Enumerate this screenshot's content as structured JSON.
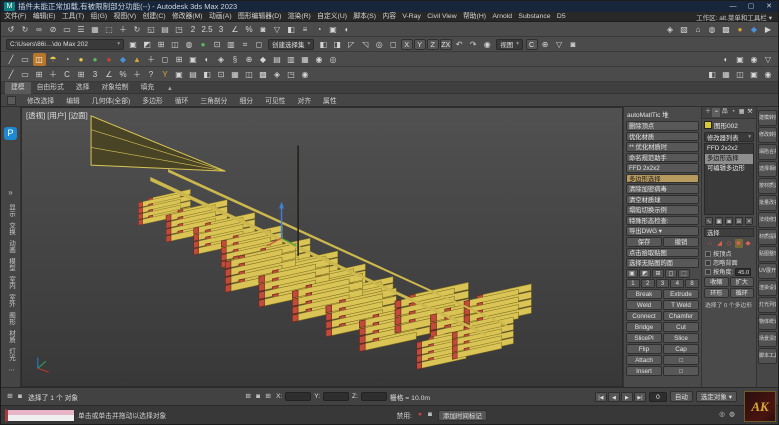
{
  "titlebar": {
    "app_icon": "M",
    "title": "插件未能正常加载,有被限制部分功能(--) - Autodesk 3ds Max 2023",
    "minimize": "—",
    "maximize": "▢",
    "close": "✕"
  },
  "menubar": {
    "items": [
      "文件(F)",
      "编辑(E)",
      "工具(T)",
      "组(G)",
      "视图(V)",
      "创建(C)",
      "修改器(M)",
      "动画(A)",
      "图形编辑器(D)",
      "渲染(R)",
      "自定义(U)",
      "脚本(S)",
      "内容",
      "V-Ray",
      "Civil View",
      "帮助(H)",
      "Arnold",
      "Substance",
      "D5"
    ],
    "workspace": "工作区: alt.菜单和工具栏 ▾"
  },
  "toolbar_row1": {
    "icons": [
      {
        "g": "↺"
      },
      {
        "g": "↻"
      },
      {
        "g": "∞"
      },
      {
        "g": "⊘"
      },
      {
        "g": "▭"
      },
      {
        "g": "☰"
      },
      {
        "g": "▦"
      },
      {
        "g": "⬚"
      },
      {
        "g": "＋"
      },
      {
        "g": "↻"
      },
      {
        "g": "◱"
      },
      {
        "g": "▤"
      },
      {
        "g": "◳"
      },
      {
        "g": "2"
      },
      {
        "g": "2.5"
      },
      {
        "g": "3"
      },
      {
        "g": "∠"
      },
      {
        "g": "%"
      },
      {
        "g": "◙"
      },
      {
        "g": "▽"
      },
      {
        "g": "◧"
      },
      {
        "g": "≡"
      },
      {
        "g": "◔"
      },
      {
        "g": "▣"
      },
      {
        "g": "◐"
      }
    ],
    "icons_right": [
      {
        "g": "◈"
      },
      {
        "g": "▧"
      },
      {
        "g": "⌂"
      },
      {
        "g": "◍"
      },
      {
        "g": "▩"
      },
      {
        "g": "●",
        "c": "#d9a33a"
      },
      {
        "g": "◆",
        "c": "#4a90d9"
      },
      {
        "g": "▶"
      }
    ]
  },
  "toolbar_row2": {
    "path": "C:\\Users\\86i…\\do Max 202",
    "icons_a": [
      {
        "g": "▣"
      },
      {
        "g": "◩"
      },
      {
        "g": "⊞"
      },
      {
        "g": "◫"
      },
      {
        "g": "◍"
      },
      {
        "g": "●",
        "c": "#5cb85c"
      },
      {
        "g": "⊡"
      },
      {
        "g": "▥"
      },
      {
        "g": "⌗"
      },
      {
        "g": "◻"
      }
    ],
    "sel_combo": "创建选择集",
    "icons_b": [
      {
        "g": "◧"
      },
      {
        "g": "◨"
      },
      {
        "g": "◸"
      },
      {
        "g": "◹"
      },
      {
        "g": "◎"
      },
      {
        "g": "◻"
      }
    ],
    "axis": [
      "X",
      "Y",
      "Z",
      "ZX"
    ],
    "icons_c": [
      {
        "g": "↶"
      },
      {
        "g": "↷"
      },
      {
        "g": "◉"
      }
    ],
    "view_combo": "视图",
    "c_btn": "C",
    "icons_d": [
      {
        "g": "⊕"
      },
      {
        "g": "▽"
      },
      {
        "g": "◙"
      }
    ]
  },
  "toolbar_row3": {
    "icons": [
      {
        "g": "╱"
      },
      {
        "g": "▭"
      },
      {
        "g": "◫",
        "bg": "#b8762a",
        "c": "#ffffff"
      },
      {
        "g": "☂",
        "c": "#e6c84a"
      },
      {
        "g": "◔"
      },
      {
        "g": "●",
        "c": "#e6c84a"
      },
      {
        "g": "●",
        "c": "#5cb85c"
      },
      {
        "g": "●",
        "c": "#cc4433"
      },
      {
        "g": "◆",
        "c": "#4a90d9"
      },
      {
        "g": "▲",
        "c": "#d9a33a"
      },
      {
        "g": "＋"
      },
      {
        "g": "◻"
      },
      {
        "g": "⊞"
      },
      {
        "g": "▣"
      },
      {
        "g": "◐"
      },
      {
        "g": "◈"
      },
      {
        "g": "§"
      },
      {
        "g": "⊕"
      },
      {
        "g": "◆"
      },
      {
        "g": "▤"
      },
      {
        "g": "▥"
      },
      {
        "g": "▦"
      },
      {
        "g": "◉"
      },
      {
        "g": "◎"
      }
    ],
    "icons_right": [
      {
        "g": "◐"
      },
      {
        "g": "▣"
      },
      {
        "g": "◉"
      },
      {
        "g": "▽"
      }
    ]
  },
  "toolbar_row4": {
    "icons": [
      {
        "g": "╱"
      },
      {
        "g": "▭"
      },
      {
        "g": "⊞"
      },
      {
        "g": "＋"
      },
      {
        "g": "C"
      },
      {
        "g": "⊞"
      },
      {
        "g": "3"
      },
      {
        "g": "∠"
      },
      {
        "g": "%"
      },
      {
        "g": "＋"
      },
      {
        "g": "?"
      },
      {
        "g": "Y",
        "c": "#d9a33a"
      },
      {
        "g": "▣"
      },
      {
        "g": "▤"
      },
      {
        "g": "◧"
      },
      {
        "g": "⊡"
      },
      {
        "g": "▦"
      },
      {
        "g": "◫"
      },
      {
        "g": "▩"
      },
      {
        "g": "◈"
      },
      {
        "g": "◳"
      },
      {
        "g": "◉"
      }
    ],
    "icons_right": [
      {
        "g": "◧"
      },
      {
        "g": "▦"
      },
      {
        "g": "◫"
      },
      {
        "g": "▣"
      },
      {
        "g": "◉"
      }
    ]
  },
  "ribbon": {
    "tabs": [
      {
        "t": "建模",
        "bg": "#5a5a5a"
      },
      {
        "t": "自由形式"
      },
      {
        "t": "选择"
      },
      {
        "t": "对象绘制"
      },
      {
        "t": "填充"
      }
    ],
    "collapse": "▴",
    "panels": [
      "修改选择",
      "编辑",
      "几何体(全部)",
      "多边形",
      "循环",
      "三角剖分",
      "细分",
      "可见性",
      "对齐",
      "属性"
    ]
  },
  "left_strip": {
    "p_icon": "P",
    "chevron": "»",
    "items": [
      "显示",
      "交换",
      "动画",
      "模型",
      "室内",
      "室外",
      "图形",
      "材质",
      "灯光",
      "⋯"
    ]
  },
  "viewport": {
    "label": "[透视] [用户] [边面]"
  },
  "panelA": {
    "title": "autoMatlTic 堆",
    "list": [
      {
        "t": "删除顶点"
      },
      {
        "t": "优化材质"
      },
      {
        "t": "** 优化材质时"
      },
      {
        "t": "命名规范助手"
      },
      {
        "t": "FFD 2x2x2"
      },
      {
        "t": "多边形选择",
        "bg": "#b79a5e",
        "fg": "#1b1b1b"
      },
      {
        "t": "清除加密病毒"
      },
      {
        "t": "清空材质球"
      },
      {
        "t": "塌陷切换示例"
      },
      {
        "t": "特殊形态检查:"
      },
      {
        "t": "导出DWG ▾"
      }
    ],
    "small_btns": [
      "保存",
      "撤销"
    ],
    "wide_btns": [
      "点击拾取贴图",
      "选择无贴图的面"
    ],
    "mini_icons": [
      {
        "g": "▣"
      },
      {
        "g": "◩"
      },
      {
        "g": "⊞"
      },
      {
        "g": "◻"
      },
      {
        "g": "⬚"
      }
    ],
    "numbers": [
      "1",
      "2",
      "3",
      "4",
      "8"
    ],
    "pairs": [
      [
        "Break",
        "Extrude"
      ],
      [
        "Weld",
        "T Weld"
      ],
      [
        "Connect",
        "Chamfer"
      ],
      [
        "Bridge",
        "Cut"
      ],
      [
        "SlicePl",
        "Slice"
      ],
      [
        "Flip",
        "Cap"
      ],
      [
        "Attach",
        "□"
      ],
      [
        "Insert",
        "□"
      ]
    ]
  },
  "panelB": {
    "tabs": [
      {
        "g": "＋"
      },
      {
        "g": "⌁",
        "bg": "#5f5f5f"
      },
      {
        "g": "品"
      },
      {
        "g": "◔"
      },
      {
        "g": "▦"
      },
      {
        "g": "⚒"
      }
    ],
    "object_name": "图形002",
    "swatch": "#d8c832",
    "modifier_list": "修改器列表",
    "dropdown": "▾",
    "stack": [
      {
        "t": "FFD 2x2x2"
      },
      {
        "t": "多边形选择",
        "bg": "#8f8f8f",
        "fg": "#141414"
      },
      {
        "t": "可编辑多边形"
      }
    ],
    "stack_btns": [
      {
        "g": "∿"
      },
      {
        "g": "▣"
      },
      {
        "g": "◙"
      },
      {
        "g": "⊞"
      },
      {
        "g": "✕"
      }
    ],
    "sel": {
      "header": "选择",
      "icons": [
        {
          "g": "∴",
          "c": "#e0614f"
        },
        {
          "g": "◢",
          "c": "#e0614f"
        },
        {
          "g": "◇",
          "c": "#e0614f"
        },
        {
          "g": "■",
          "c": "#e0614f",
          "bg": "#7a6a3a"
        },
        {
          "g": "◆",
          "c": "#e0614f"
        }
      ],
      "checks": [
        "按顶点",
        "忽略背面"
      ],
      "angle_label": "按角度:",
      "angle_value": "45.0",
      "btns1": [
        "收缩",
        "扩大"
      ],
      "btns2": [
        "环形",
        "循环"
      ],
      "info": "选择了 0 个多边形"
    }
  },
  "panelC": {
    "items": [
      "建模转换",
      "修改转换",
      "塌陷合并",
      "选择相似",
      "按材质选",
      "批量改名",
      "法线修复",
      "材质提取",
      "贴图整理",
      "UV展开",
      "渲染设置",
      "灯光列表",
      "物体统计",
      "场景清理",
      "脚本工具"
    ]
  },
  "statusbar": {
    "row1": {
      "left_icons": [
        {
          "g": "⊞"
        },
        {
          "g": "◙"
        }
      ],
      "status": "选择了 1 个 对象",
      "xyz_icons": [
        {
          "g": "⊞"
        },
        {
          "g": "◙"
        },
        {
          "g": "⊞"
        }
      ],
      "x_label": "X:",
      "y_label": "Y:",
      "z_label": "Z:",
      "grid": "栅格 = 10.0m",
      "transport": [
        "|◀",
        "◀",
        "▶",
        "▶|"
      ],
      "frame": "0",
      "auto_key": "自动",
      "sel_set": "选定对象 ▾"
    },
    "row2": {
      "hint": "单击或单击并拖动以选择对象",
      "mute_label": "禁用:",
      "mute_icons": [
        {
          "g": "●",
          "c": "#d04040"
        },
        {
          "g": "◙"
        }
      ],
      "time_tag": "添加时间标记",
      "right_icons": [
        {
          "g": "◎"
        },
        {
          "g": "◍"
        }
      ]
    },
    "ak": "AK"
  }
}
